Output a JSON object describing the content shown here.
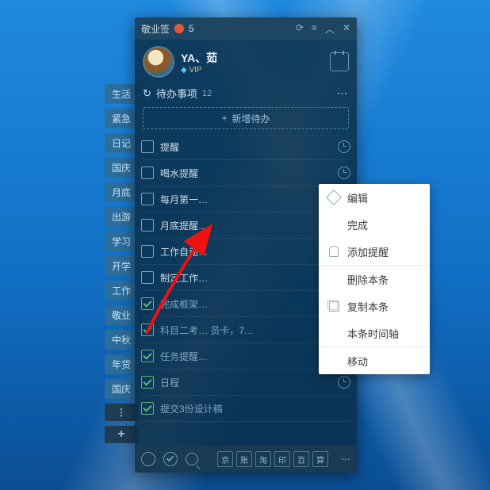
{
  "titlebar": {
    "app": "敬业签",
    "count": "5"
  },
  "profile": {
    "name": "YA、茹",
    "vip": "VIP"
  },
  "section": {
    "title": "待办事项",
    "count": "12"
  },
  "add_label": "新增待办",
  "tags": [
    "生活",
    "紧急",
    "日记",
    "国庆",
    "月底",
    "出游",
    "学习",
    "开学",
    "工作",
    "敬业",
    "中秋",
    "年货",
    "国庆"
  ],
  "items": [
    {
      "label": "提醒",
      "done": false,
      "clock": "norm"
    },
    {
      "label": "喝水提醒",
      "done": false,
      "clock": "norm"
    },
    {
      "label": "每月第一…",
      "done": false,
      "clock": "norm"
    },
    {
      "label": "月底提醒…",
      "done": false,
      "clock": "norm"
    },
    {
      "label": "工作自动…",
      "done": false,
      "clock": "norm"
    },
    {
      "label": "制定工作…",
      "done": false,
      "clock": "warn"
    },
    {
      "label": "完成框架…",
      "done": true,
      "clock": "norm",
      "tail": ""
    },
    {
      "label": "科目二考…     员卡，7…",
      "done": true,
      "clock": ""
    },
    {
      "label": "任务提醒…",
      "done": true,
      "clock": "norm"
    },
    {
      "label": "日程",
      "done": true,
      "clock": "norm"
    },
    {
      "label": "提交3份设计稿",
      "done": true,
      "clock": ""
    }
  ],
  "bottom": [
    "京",
    "账",
    "淘",
    "印",
    "百",
    "算"
  ],
  "menu": [
    {
      "icon": "pencil",
      "label": "编辑"
    },
    {
      "icon": "",
      "label": "完成"
    },
    {
      "icon": "bell",
      "label": "添加提醒",
      "divider_after": true
    },
    {
      "icon": "",
      "label": "删除本条"
    },
    {
      "icon": "copy",
      "label": "复制本条"
    },
    {
      "icon": "",
      "label": "本条时间轴",
      "divider_after": true
    },
    {
      "icon": "",
      "label": "移动"
    }
  ]
}
